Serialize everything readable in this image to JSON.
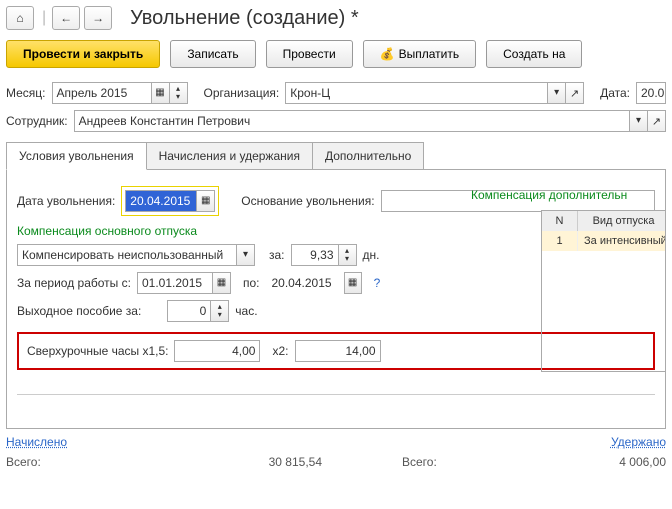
{
  "title": "Увольнение (создание) *",
  "toolbar": {
    "primary": "Провести и закрыть",
    "save": "Записать",
    "post": "Провести",
    "pay": "Выплатить",
    "create": "Создать на"
  },
  "header": {
    "month_label": "Месяц:",
    "month_value": "Апрель 2015",
    "org_label": "Организация:",
    "org_value": "Крон-Ц",
    "date_label": "Дата:",
    "date_value": "20.0",
    "emp_label": "Сотрудник:",
    "emp_value": "Андреев Константин Петрович"
  },
  "tabs": {
    "t1": "Условия увольнения",
    "t2": "Начисления и удержания",
    "t3": "Дополнительно"
  },
  "fire": {
    "date_label": "Дата увольнения:",
    "date_value": "20.04.2015",
    "reason_label": "Основание увольнения:",
    "comp_title": "Компенсация основного отпуска",
    "comp_type": "Компенсировать неиспользованный",
    "za_label": "за:",
    "days_value": "9,33",
    "days_unit": "дн.",
    "period_label": "За период работы с:",
    "period_from": "01.01.2015",
    "po_label": "по:",
    "period_to": "20.04.2015",
    "severance_label": "Выходное пособие за:",
    "severance_value": "0",
    "severance_unit": "час.",
    "overtime15_label": "Сверхурочные часы x1,5:",
    "overtime15_value": "4,00",
    "overtime2_label": "x2:",
    "overtime2_value": "14,00",
    "qmark": "?",
    "comp2_title": "Компенсация дополнительн",
    "table_head_n": "N",
    "table_head_v": "Вид отпуска",
    "row1_n": "1",
    "row1_v": "За интенсивный т"
  },
  "totals": {
    "accrued_label": "Начислено",
    "withheld_label": "Удержано",
    "total_label": "Всего:",
    "accrued_value": "30 815,54",
    "withheld_value": "4 006,00"
  },
  "icons": {
    "home": "⌂",
    "back": "←",
    "fwd": "→",
    "money": "💰"
  }
}
